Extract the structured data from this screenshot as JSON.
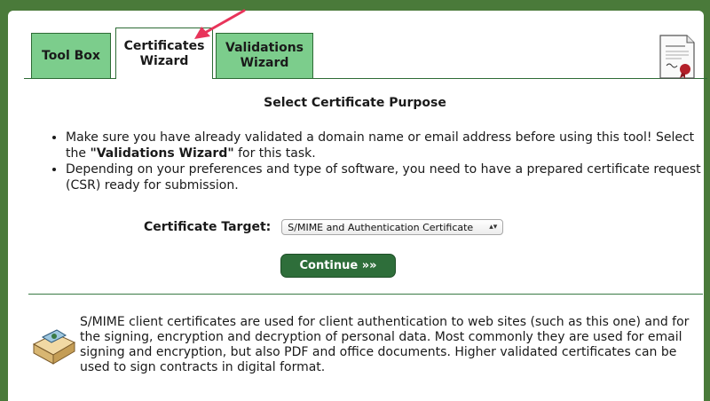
{
  "tabs": [
    {
      "label": "Tool Box"
    },
    {
      "label": "Certificates Wizard"
    },
    {
      "label": "Validations Wizard"
    }
  ],
  "title": "Select Certificate Purpose",
  "bullet1_pre": "Make sure you have already validated a domain name or email address before using this tool! Select the ",
  "bullet1_strong": "\"Validations Wizard\"",
  "bullet1_post": " for this task.",
  "bullet2": "Depending on your preferences and type of software, you need to have a prepared certificate request (CSR) ready for submission.",
  "target_label": "Certificate Target:",
  "target_value": "S/MIME and Authentication Certificate",
  "continue_label": "Continue »»",
  "info_text": "S/MIME client certificates are used for client authentication to web sites (such as this one) and for the signing, encryption and decryption of personal data. Most commonly they are used for email signing and encryption, but also PDF and office documents. Higher validated certificates can be used to sign contracts in digital format.",
  "colors": {
    "accent": "#2e6e3a",
    "tab": "#7ccd8c",
    "arrow": "#e8345a"
  }
}
